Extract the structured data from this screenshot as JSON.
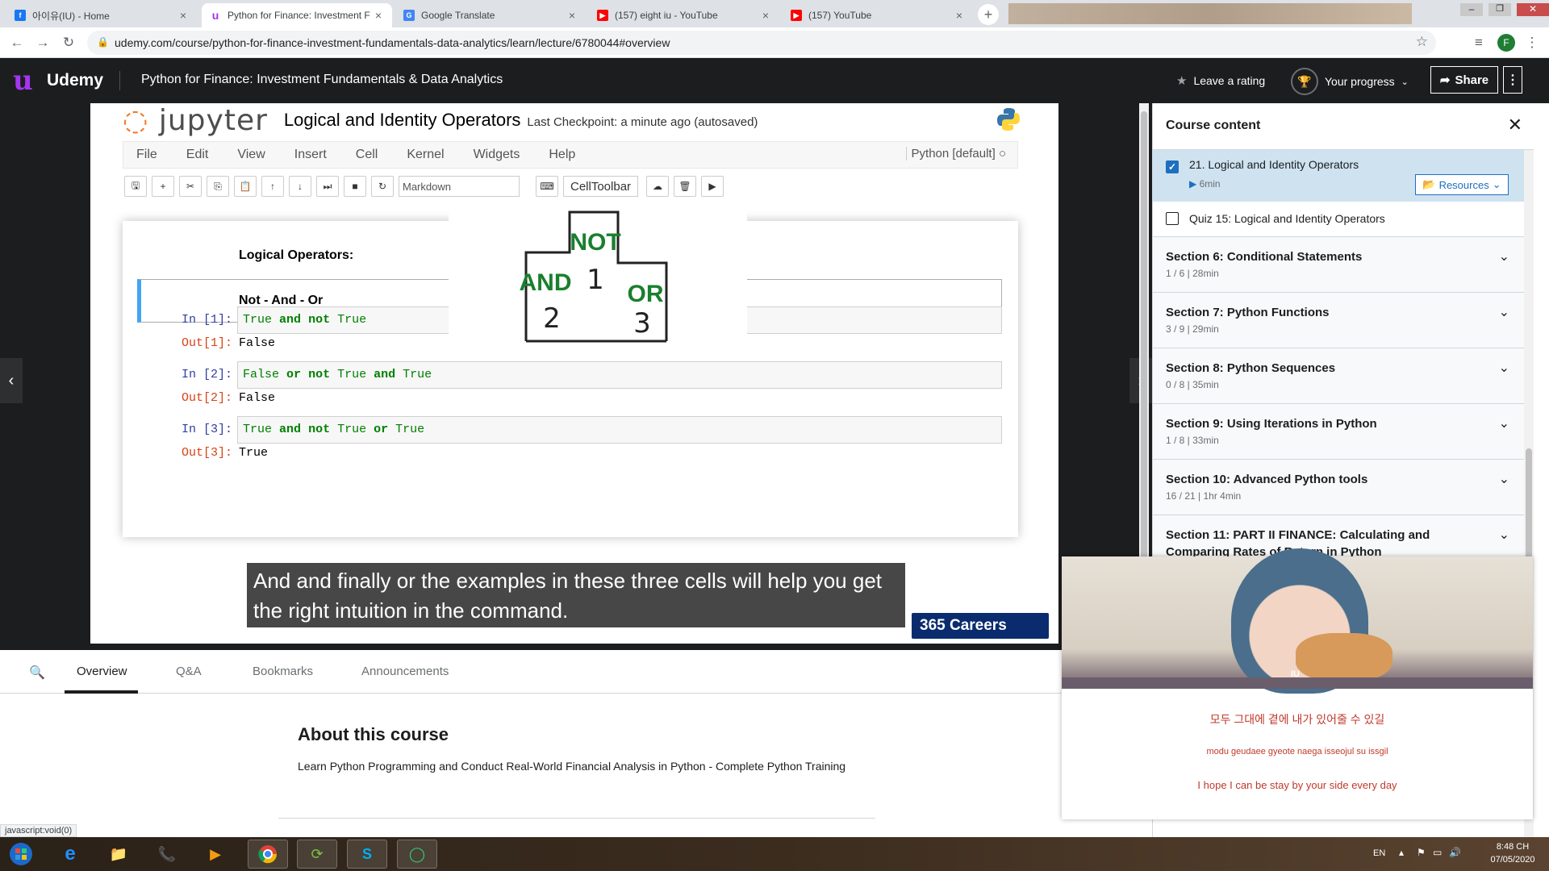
{
  "browser": {
    "tabs": [
      {
        "title": "아이유(IU) - Home",
        "icon": "facebook-icon",
        "color": "#1877f2",
        "active": false
      },
      {
        "title": "Python for Finance: Investment F",
        "icon": "udemy-icon",
        "color": "#a435f0",
        "active": true
      },
      {
        "title": "Google Translate",
        "icon": "google-translate-icon",
        "color": "#4285f4",
        "active": false
      },
      {
        "title": "(157) eight iu - YouTube",
        "icon": "youtube-icon",
        "color": "#ff0000",
        "active": false
      },
      {
        "title": "(157) YouTube",
        "icon": "youtube-icon",
        "color": "#ff0000",
        "active": false
      }
    ],
    "url": "udemy.com/course/python-for-finance-investment-fundamentals-data-analytics/learn/lecture/6780044#overview",
    "profile_initial": "F"
  },
  "header": {
    "brand": "Udemy",
    "course_title": "Python for Finance: Investment Fundamentals & Data Analytics",
    "leave_rating": "Leave a rating",
    "progress_label": "Your progress",
    "share_label": "Share"
  },
  "notebook": {
    "logo": "jupyter",
    "title": "Logical and Identity Operators",
    "checkpoint": "Last Checkpoint: a minute ago (autosaved)",
    "menu": [
      "File",
      "Edit",
      "View",
      "Insert",
      "Cell",
      "Kernel",
      "Widgets",
      "Help"
    ],
    "kernel": "Python [default]",
    "cell_type": "Markdown",
    "celltoolbar": "CellToolbar",
    "heading": "Logical Operators:",
    "subheading": "Not - And - Or",
    "cells": [
      {
        "in": "In [1]:",
        "out": "Out[1]:",
        "result": "False"
      },
      {
        "in": "In [2]:",
        "out": "Out[2]:",
        "result": "False"
      },
      {
        "in": "In [3]:",
        "out": "Out[3]:",
        "result": "True"
      }
    ],
    "code": {
      "c1": [
        "True",
        " ",
        "and",
        " ",
        "not",
        " ",
        "True"
      ],
      "c2": [
        "False",
        " ",
        "or",
        " ",
        "not",
        " ",
        "True",
        " ",
        "and",
        " ",
        "True"
      ],
      "c3": [
        "True",
        " ",
        "and",
        " ",
        "not",
        " ",
        "True",
        " ",
        "or",
        " ",
        "True"
      ]
    }
  },
  "podium": {
    "top": "NOT",
    "left": "AND",
    "right": "OR",
    "first": "1",
    "second": "2",
    "third": "3"
  },
  "subtitle": "And and finally or the examples in these three cells will help you get the right intuition in the command.",
  "watermark": "365 Careers",
  "sidebar": {
    "title": "Course content",
    "current": {
      "title": "21. Logical and Identity Operators",
      "duration": "6min",
      "resources": "Resources"
    },
    "quiz": "Quiz 15: Logical and Identity Operators",
    "sections": [
      {
        "title": "Section 6: Conditional Statements",
        "meta": "1 / 6 | 28min"
      },
      {
        "title": "Section 7: Python Functions",
        "meta": "3 / 9 | 29min"
      },
      {
        "title": "Section 8: Python Sequences",
        "meta": "0 / 8 | 35min"
      },
      {
        "title": "Section 9: Using Iterations in Python",
        "meta": "1 / 8 | 33min"
      },
      {
        "title": "Section 10: Advanced Python tools",
        "meta": "16 / 21 | 1hr 4min"
      },
      {
        "title": "Section 11: PART II FINANCE: Calculating and Comparing Rates of Return in Python",
        "meta": ""
      }
    ]
  },
  "bottom": {
    "tabs": [
      "Overview",
      "Q&A",
      "Bookmarks",
      "Announcements"
    ],
    "about_title": "About this course",
    "about_desc": "Learn Python Programming and Conduct Real-World Financial Analysis in Python - Complete Python Training",
    "status": "javascript:void(0)"
  },
  "mini_player": {
    "mark": "IU",
    "lyric_ko": "모두 그대에 곁에 내가 있어줄 수 있길",
    "lyric_rom": "modu geudaee gyeote naega isseojul su issgil",
    "lyric_en": "I hope I can be stay by your side every day"
  },
  "taskbar": {
    "lang": "EN",
    "time": "8:48 CH",
    "date": "07/05/2020"
  }
}
